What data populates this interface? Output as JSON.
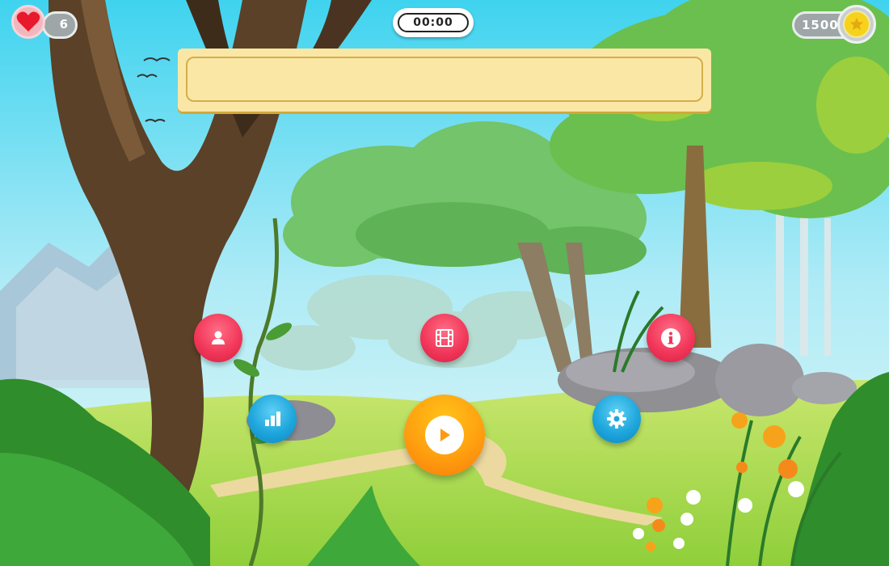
{
  "hud": {
    "lives": "6",
    "timer": "00:00",
    "coins": "1500"
  },
  "banner": {
    "text": ""
  },
  "icons": {
    "lives": "heart-icon",
    "coins": "star-coin-icon",
    "profile": "user-icon",
    "video": "film-icon",
    "info": "info-icon",
    "stats": "bar-chart-icon",
    "settings": "gear-icon",
    "play": "play-icon"
  },
  "colors": {
    "primary_button": "#f2385a",
    "secondary_button": "#1ea6dc",
    "play_button": "#ffa310",
    "banner": "#fbe7a5",
    "heart": "#e8192c",
    "coin": "#f7d21c"
  }
}
